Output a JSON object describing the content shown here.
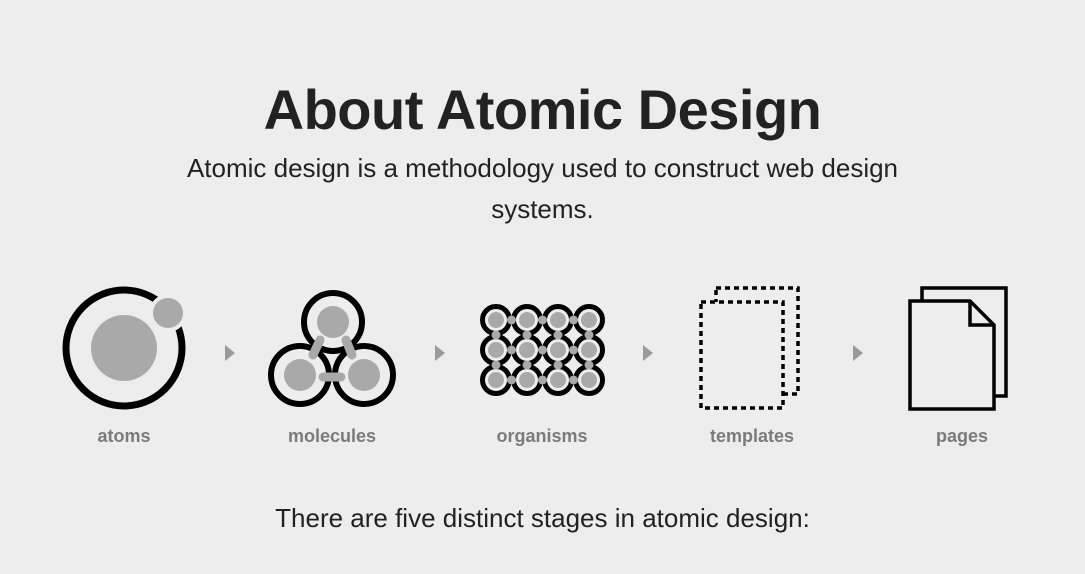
{
  "title": "About Atomic Design",
  "intro": "Atomic design is a methodology used to construct web design systems.",
  "stages": [
    {
      "label": "atoms",
      "icon": "atom-icon"
    },
    {
      "label": "molecules",
      "icon": "molecule-icon"
    },
    {
      "label": "organisms",
      "icon": "organism-icon"
    },
    {
      "label": "templates",
      "icon": "template-icon"
    },
    {
      "label": "pages",
      "icon": "pages-icon"
    }
  ],
  "arrow_icon": "triangle-right-icon",
  "footer": "There are five distinct stages in atomic design:",
  "colors": {
    "background": "#ededed",
    "ink": "#000000",
    "fill_gray": "#a9a9a9",
    "label_gray": "#7b7b7b",
    "arrow_gray": "#9a9a9a"
  }
}
